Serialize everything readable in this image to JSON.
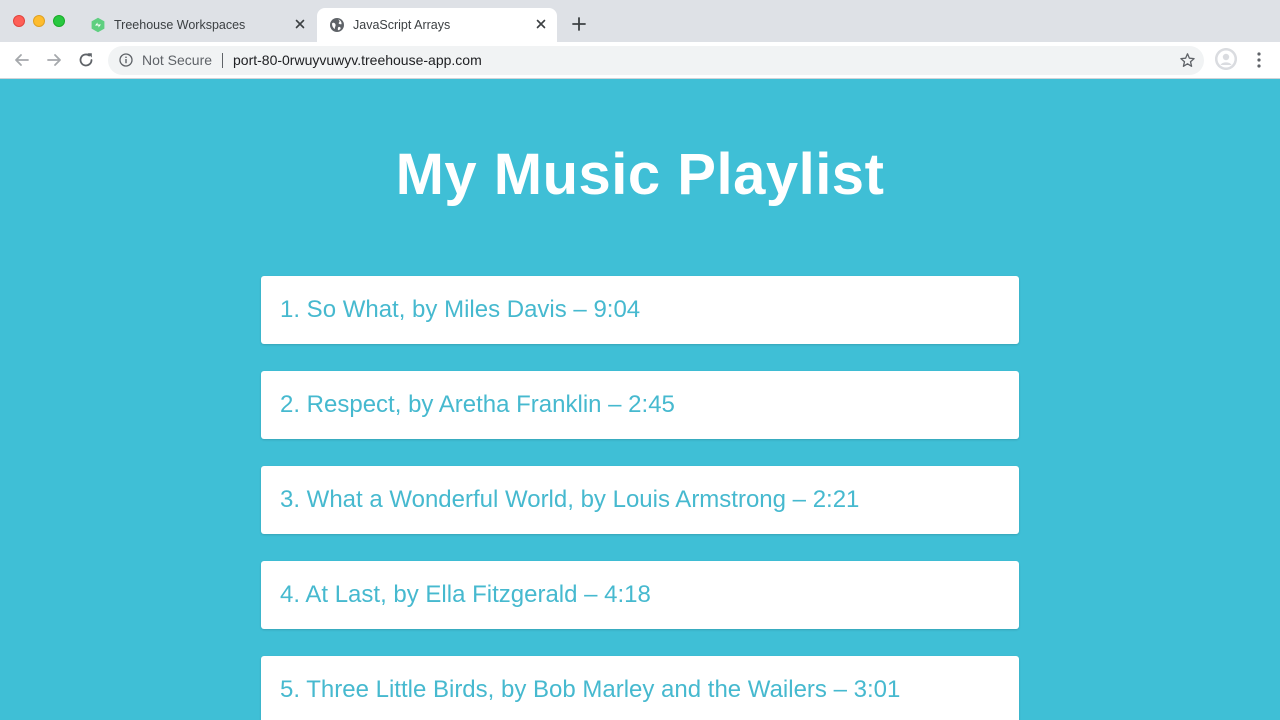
{
  "browser": {
    "tabs": [
      {
        "title": "Treehouse Workspaces",
        "active": false
      },
      {
        "title": "JavaScript Arrays",
        "active": true
      }
    ],
    "address_bar": {
      "security_label": "Not Secure",
      "url": "port-80-0rwuyvuwyv.treehouse-app.com"
    }
  },
  "page": {
    "title": "My Music Playlist",
    "tracks": [
      "1. So What, by Miles Davis – 9:04",
      "2. Respect, by Aretha Franklin – 2:45",
      "3. What a Wonderful World, by Louis Armstrong – 2:21",
      "4. At Last, by Ella Fitzgerald – 4:18",
      "5. Three Little Birds, by Bob Marley and the Wailers – 3:01"
    ]
  },
  "colors": {
    "page_background": "#3fbfd6",
    "track_text": "#46b9cf",
    "card_background": "#ffffff",
    "tab_strip": "#dee1e6"
  },
  "icons": {
    "treehouse_favicon": "treehouse-icon",
    "active_tab_favicon": "globe-icon",
    "tab_close": "close-icon",
    "new_tab": "plus-icon",
    "back": "arrow-left-icon",
    "forward": "arrow-right-icon",
    "reload": "reload-icon",
    "info": "info-icon",
    "bookmark": "star-icon",
    "profile": "avatar-icon",
    "menu": "more-vertical-icon"
  }
}
